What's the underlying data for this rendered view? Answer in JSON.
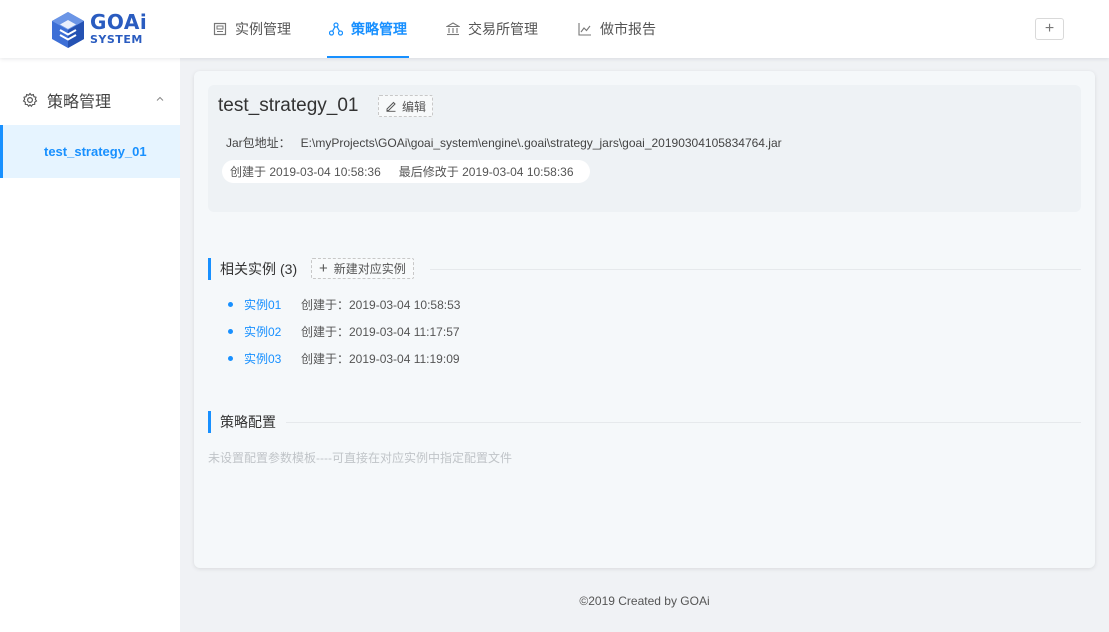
{
  "brand": {
    "title": "GOAi",
    "subtitle": "SYSTEM",
    "colors": {
      "primary": "#1890ff",
      "logo": "#2a5cc0"
    }
  },
  "nav": {
    "items": [
      {
        "label": "实例管理",
        "icon": "instance-icon"
      },
      {
        "label": "策略管理",
        "icon": "strategy-icon",
        "active": true
      },
      {
        "label": "交易所管理",
        "icon": "bank-icon"
      },
      {
        "label": "做市报告",
        "icon": "line-chart-icon"
      }
    ],
    "add_label": "+"
  },
  "sidebar": {
    "group_label": "策略管理",
    "items": [
      {
        "label": "test_strategy_01",
        "selected": true
      }
    ]
  },
  "strategy": {
    "name": "test_strategy_01",
    "edit_label": "编辑",
    "jar_label": "Jar包地址：",
    "jar_path": "E:\\myProjects\\GOAi\\goai_system\\engine\\.goai\\strategy_jars\\goai_20190304105834764.jar",
    "created": "创建于 2019-03-04 10:58:36",
    "modified": "最后修改于 2019-03-04 10:58:36"
  },
  "instances_section": {
    "title": "相关实例",
    "count": "(3)",
    "new_label": "新建对应实例",
    "items": [
      {
        "name": "实例01",
        "created": "创建于：2019-03-04 10:58:53"
      },
      {
        "name": "实例02",
        "created": "创建于：2019-03-04 11:17:57"
      },
      {
        "name": "实例03",
        "created": "创建于：2019-03-04 11:19:09"
      }
    ]
  },
  "config_section": {
    "title": "策略配置",
    "empty_text": "未设置配置参数模板----可直接在对应实例中指定配置文件"
  },
  "footer": {
    "text": "©2019 Created by GOAi"
  }
}
